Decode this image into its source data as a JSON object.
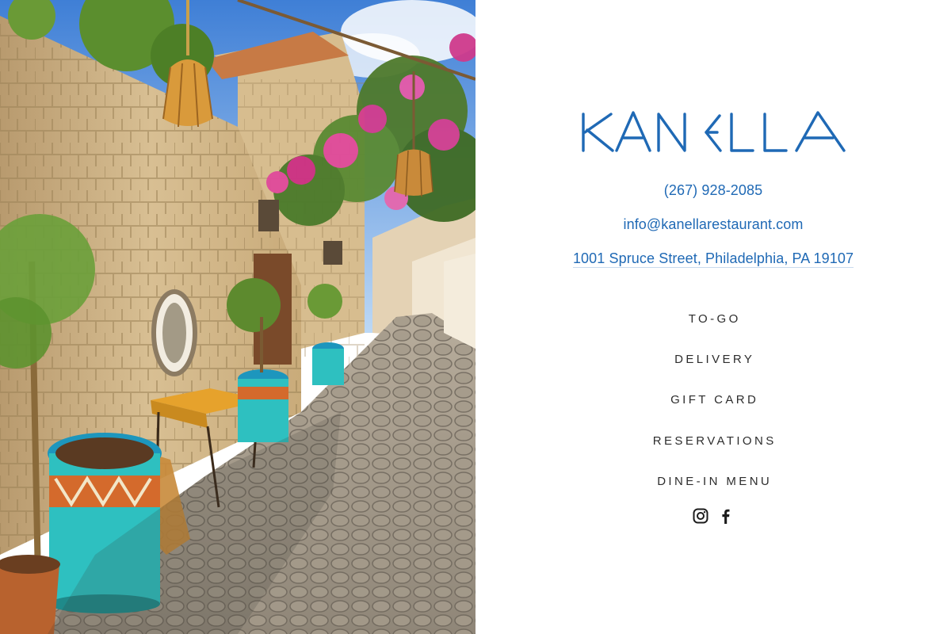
{
  "brand": {
    "name": "KANELLA",
    "color": "#1f69b5"
  },
  "contact": {
    "phone": "(267) 928-2085",
    "email": "info@kanellarestaurant.com",
    "address": "1001 Spruce Street, Philadelphia, PA 19107",
    "link_color": "#1f69b5"
  },
  "nav": {
    "items": [
      {
        "label": "TO-GO"
      },
      {
        "label": "DELIVERY"
      },
      {
        "label": "GIFT CARD"
      },
      {
        "label": "RESERVATIONS"
      },
      {
        "label": "DINE-IN MENU"
      }
    ]
  },
  "social": {
    "icons": [
      "instagram-icon",
      "facebook-icon"
    ]
  }
}
